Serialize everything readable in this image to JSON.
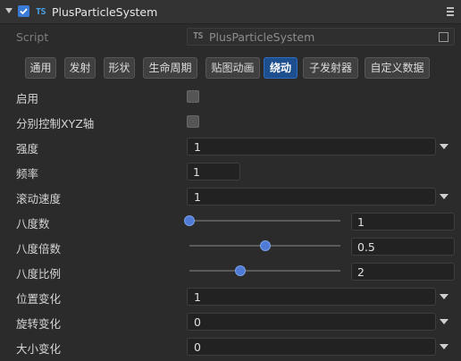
{
  "header": {
    "title": "PlusParticleSystem",
    "ts_badge": "TS",
    "enabled": true,
    "icons": [
      "collapse-arrow-icon",
      "checkbox-icon",
      "typescript-icon",
      "menu-icon"
    ]
  },
  "script": {
    "label": "Script",
    "value": "PlusParticleSystem",
    "ts_badge": "TS"
  },
  "tabs": [
    {
      "label": "通用"
    },
    {
      "label": "发射"
    },
    {
      "label": "形状"
    },
    {
      "label": "生命周期"
    },
    {
      "label": "贴图动画"
    },
    {
      "label": "绕动",
      "active": true
    },
    {
      "label": "子发射器"
    },
    {
      "label": "自定义数据"
    }
  ],
  "props": {
    "enable": {
      "label": "启用",
      "checked": false
    },
    "separate_xyz": {
      "label": "分别控制XYZ轴",
      "checked": false
    },
    "strength": {
      "label": "强度",
      "value": "1"
    },
    "frequency": {
      "label": "频率",
      "value": "1"
    },
    "scroll_speed": {
      "label": "滚动速度",
      "value": "1"
    },
    "octaves": {
      "label": "八度数",
      "value": "1",
      "slider": 0.0
    },
    "octave_multiplier": {
      "label": "八度倍数",
      "value": "0.5",
      "slider": 0.5
    },
    "octave_scale": {
      "label": "八度比例",
      "value": "2",
      "slider": 0.34
    },
    "position_amount": {
      "label": "位置变化",
      "value": "1"
    },
    "rotation_amount": {
      "label": "旋转变化",
      "value": "0"
    },
    "size_amount": {
      "label": "大小变化",
      "value": "0"
    }
  },
  "colors": {
    "accent": "#3a7bd5",
    "active_tab": "#1d4f8f",
    "background": "#2b2b2b"
  }
}
